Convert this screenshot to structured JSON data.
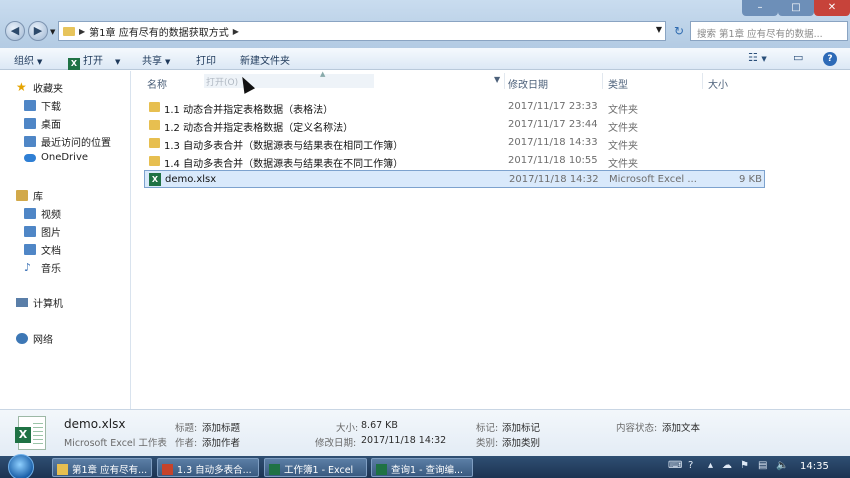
{
  "address": {
    "crumbs": [
      "第1章 应有尽有的数据获取方式"
    ],
    "search_placeholder": "搜索 第1章 应有尽有的数据..."
  },
  "toolbar": {
    "organize": "组织",
    "open": "打开",
    "share": "共享",
    "print": "打印",
    "new_folder": "新建文件夹"
  },
  "sidebar": {
    "favorites": "收藏夹",
    "downloads": "下载",
    "desktop": "桌面",
    "recent": "最近访问的位置",
    "onedrive": "OneDrive",
    "library": "库",
    "videos": "视频",
    "pictures": "图片",
    "documents": "文档",
    "music": "音乐",
    "computer": "计算机",
    "network": "网络"
  },
  "columns": {
    "name": "名称",
    "date": "修改日期",
    "type": "类型",
    "size": "大小",
    "ghost": "打开(O)"
  },
  "files": [
    {
      "name": "1.1 动态合并指定表格数据（表格法）",
      "date": "2017/11/17 23:33",
      "type": "文件夹",
      "size": ""
    },
    {
      "name": "1.2 动态合并指定表格数据（定义名称法）",
      "date": "2017/11/17 23:44",
      "type": "文件夹",
      "size": ""
    },
    {
      "name": "1.3 自动多表合并（数据源表与结果表在相同工作簿）",
      "date": "2017/11/18 14:33",
      "type": "文件夹",
      "size": ""
    },
    {
      "name": "1.4 自动多表合并（数据源表与结果表在不同工作簿）",
      "date": "2017/11/18 10:55",
      "type": "文件夹",
      "size": ""
    },
    {
      "name": "demo.xlsx",
      "date": "2017/11/18 14:32",
      "type": "Microsoft Excel ...",
      "size": "9 KB"
    }
  ],
  "details": {
    "filename": "demo.xlsx",
    "filetype": "Microsoft Excel 工作表",
    "title_label": "标题:",
    "title_value": "添加标题",
    "author_label": "作者:",
    "author_value": "添加作者",
    "size_label": "大小:",
    "size_value": "8.67 KB",
    "modified_label": "修改日期:",
    "modified_value": "2017/11/18 14:32",
    "tags_label": "标记:",
    "tags_value": "添加标记",
    "category_label": "类别:",
    "category_value": "添加类别",
    "status_label": "内容状态:",
    "status_value": "添加文本"
  },
  "taskbar": {
    "tasks": [
      "第1章 应有尽有...",
      "1.3 自动多表合...",
      "工作簿1 - Excel",
      "查询1 - 查询编..."
    ],
    "time": "14:35"
  }
}
